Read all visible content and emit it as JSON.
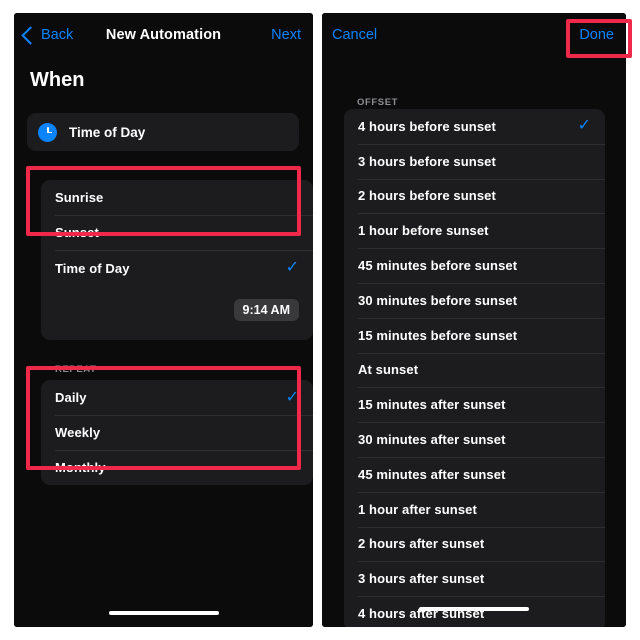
{
  "left_panel": {
    "nav": {
      "back_label": "Back",
      "title": "New Automation",
      "next_label": "Next"
    },
    "heading": "When",
    "trigger_card": {
      "icon": "clock-icon",
      "label": "Time of Day"
    },
    "trigger_options": [
      {
        "label": "Sunrise",
        "checked": false
      },
      {
        "label": "Sunset",
        "checked": false
      },
      {
        "label": "Time of Day",
        "checked": true
      }
    ],
    "time_value": "9:14 AM",
    "repeat_section_label": "REPEAT",
    "repeat_options": [
      {
        "label": "Daily",
        "checked": true
      },
      {
        "label": "Weekly",
        "checked": false
      },
      {
        "label": "Monthly",
        "checked": false
      }
    ]
  },
  "right_panel": {
    "nav": {
      "cancel_label": "Cancel",
      "done_label": "Done"
    },
    "section_label": "OFFSET",
    "offset_options": [
      {
        "label": "4 hours before sunset",
        "checked": true
      },
      {
        "label": "3 hours before sunset",
        "checked": false
      },
      {
        "label": "2 hours before sunset",
        "checked": false
      },
      {
        "label": "1 hour before sunset",
        "checked": false
      },
      {
        "label": "45 minutes before sunset",
        "checked": false
      },
      {
        "label": "30 minutes before sunset",
        "checked": false
      },
      {
        "label": "15 minutes before sunset",
        "checked": false
      },
      {
        "label": "At sunset",
        "checked": false
      },
      {
        "label": "15 minutes after sunset",
        "checked": false
      },
      {
        "label": "30 minutes after sunset",
        "checked": false
      },
      {
        "label": "45 minutes after sunset",
        "checked": false
      },
      {
        "label": "1 hour after sunset",
        "checked": false
      },
      {
        "label": "2 hours after sunset",
        "checked": false
      },
      {
        "label": "3 hours after sunset",
        "checked": false
      },
      {
        "label": "4 hours after sunset",
        "checked": false
      }
    ]
  },
  "checkmark_glyph": "✓",
  "colors": {
    "accent_blue": "#0a84ff",
    "highlight_red": "#f0284a",
    "screen_bg": "#0b0b0c",
    "card_bg": "#1c1c1e",
    "section_label": "#8e8e93"
  }
}
